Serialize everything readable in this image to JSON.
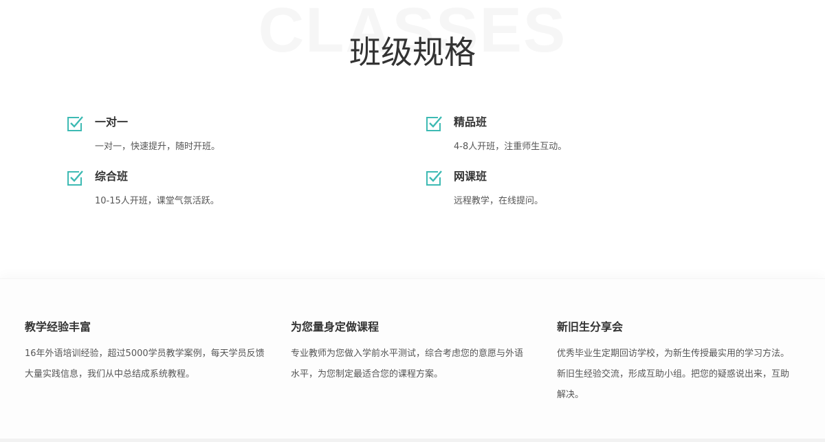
{
  "section": {
    "watermark": "CLASSES",
    "title": "班级规格"
  },
  "classes": [
    {
      "name": "一对一",
      "desc": "一对一，快速提升，随时开班。",
      "icon": "checkbox-checked-icon"
    },
    {
      "name": "精品班",
      "desc": "4-8人开班，注重师生互动。",
      "icon": "checkbox-checked-icon"
    },
    {
      "name": "综合班",
      "desc": "10-15人开班，课堂气氛活跃。",
      "icon": "checkbox-checked-icon"
    },
    {
      "name": "网课班",
      "desc": "远程教学，在线提问。",
      "icon": "checkbox-checked-icon"
    }
  ],
  "features": [
    {
      "title": "教学经验丰富",
      "text": "16年外语培训经验，超过5000学员教学案例，每天学员反馈大量实践信息，我们从中总结成系统教程。"
    },
    {
      "title": "为您量身定做课程",
      "text": "专业教师为您做入学前水平测试，综合考虑您的意愿与外语水平，为您制定最适合您的课程方案。"
    },
    {
      "title": "新旧生分享会",
      "text": "优秀毕业生定期回访学校，为新生传授最实用的学习方法。新旧生经验交流，形成互助小组。把您的疑惑说出来，互助解决。"
    }
  ],
  "colors": {
    "accent": "#3dbab3",
    "text": "#333333",
    "muted": "#555555"
  }
}
